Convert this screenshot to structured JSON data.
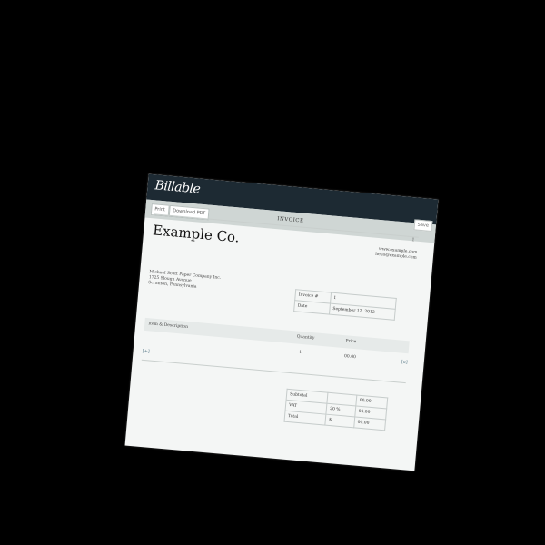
{
  "app": {
    "logo": "Billable"
  },
  "toolbar": {
    "print_label": "Print",
    "download_label": "Download PDF",
    "save_label": "Save"
  },
  "invoice": {
    "title": "INVOICE",
    "number_badge": "1",
    "company_name": "Example Co.",
    "contact_lines": [
      "www.example.com",
      "hello@example.com"
    ],
    "bill_to_lines": [
      "Michael Scott Paper Company Inc.",
      "1725 Slough Avenue",
      "Scranton, Pennsylvania"
    ],
    "meta": [
      {
        "label": "Invoice #",
        "value": "1"
      },
      {
        "label": "Date",
        "value": "September 12, 2012"
      }
    ],
    "items_header": {
      "description": "Item & Description",
      "quantity": "Quantity",
      "price": "Price"
    },
    "items": [
      {
        "description": "",
        "quantity": "1",
        "price": "00.00"
      }
    ],
    "add_row_label": "[+]",
    "delete_row_label": "[x]",
    "totals": [
      {
        "label": "Subtotal",
        "rate": "",
        "value": "00.00"
      },
      {
        "label": "VAT",
        "rate": "20 %",
        "value": "00.00"
      },
      {
        "label": "Total",
        "rate": "$",
        "value": "00.00"
      }
    ]
  }
}
